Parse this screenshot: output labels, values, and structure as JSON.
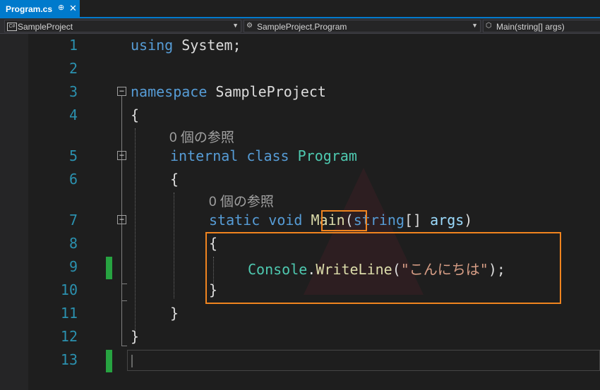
{
  "tab": {
    "label": "Program.cs",
    "pin_glyph": "⊕",
    "close_glyph": "✕"
  },
  "nav": {
    "project": "SampleProject",
    "type": "SampleProject.Program",
    "member": "Main(string[] args)",
    "project_badge": "C#"
  },
  "line_numbers": [
    "1",
    "2",
    "3",
    "4",
    "5",
    "6",
    "7",
    "8",
    "9",
    "10",
    "11",
    "12",
    "13"
  ],
  "code": {
    "using_kw": "using",
    "using_ns": "System;",
    "namespace_kw": "namespace",
    "namespace_name": "SampleProject",
    "open_brace": "{",
    "close_brace": "}",
    "codelens_refs": "0 個の参照",
    "internal_kw": "internal",
    "class_kw": "class",
    "class_name": "Program",
    "static_kw": "static",
    "void_kw": "void",
    "main_name": "Main",
    "open_paren": "(",
    "string_kw": "string",
    "array_brackets": "[]",
    "args_name": "args",
    "close_paren": ")",
    "console_type": "Console",
    "dot": ".",
    "writeline": "WriteLine",
    "string_literal": "\"こんにちは\"",
    "call_end": ");"
  },
  "colors": {
    "keyword": "#569cd6",
    "type": "#4ec9b0",
    "method": "#dcdcaa",
    "string": "#d69d85",
    "parameter": "#9cdcfe",
    "line_number": "#2b91af",
    "highlight_box": "#f0841f",
    "change_bar": "#27a341",
    "tab_active": "#007acc"
  }
}
